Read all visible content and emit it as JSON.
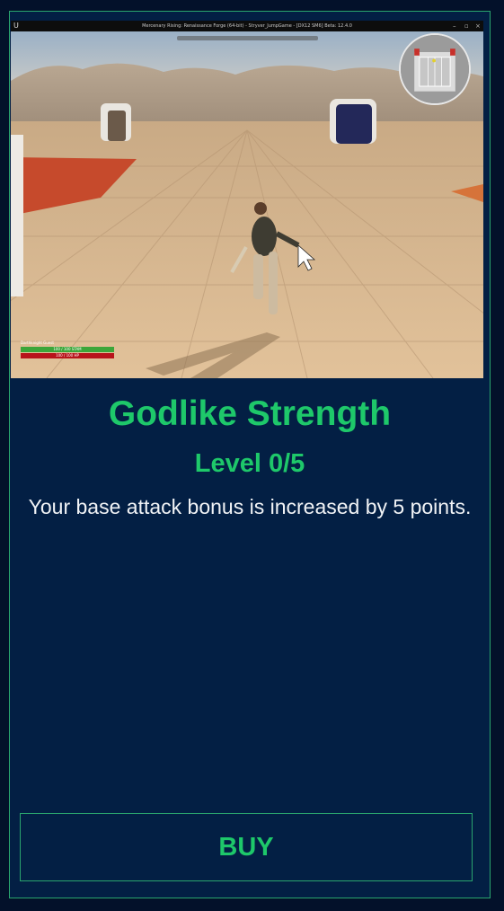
{
  "game": {
    "window_title": "Mercenary Rising: Renaissance Forge (64-bit) - Stryver_JumpGame - [DX12 SM6] Beta: 12.4.0",
    "window_controls": {
      "minimize": "–",
      "maximize": "▫",
      "close": "×"
    },
    "hud": {
      "player_name": "Darthknight Guest",
      "stamina_text": "100 / 100 STAM",
      "health_text": "100 / 100 HP"
    },
    "colors": {
      "stamina": "#3ca63a",
      "health": "#b8141b"
    }
  },
  "skill": {
    "name": "Godlike Strength",
    "level": "Level 0/5",
    "description": "Your base attack bonus is increased by 5 points."
  },
  "buy_button": {
    "label": "BUY"
  },
  "theme": {
    "panel_bg": "#031f44",
    "accent_green": "#1ec86a",
    "border_green": "#2aa56e",
    "text_light": "#f1f3f6"
  }
}
